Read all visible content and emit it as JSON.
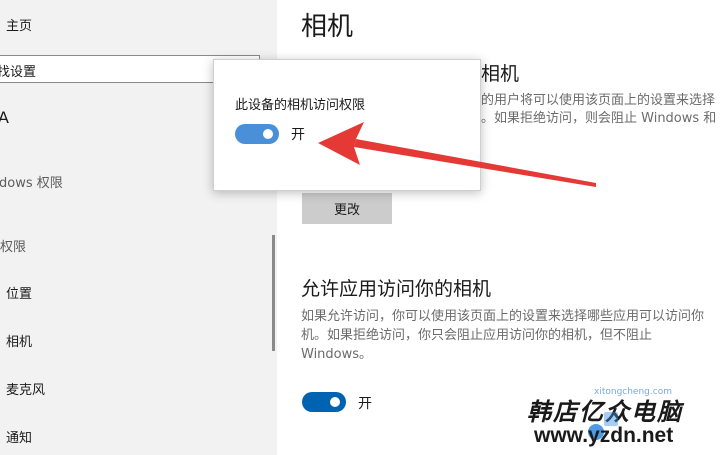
{
  "sidebar": {
    "home": "主页",
    "search_placeholder": "找设置",
    "section_fragment": "A",
    "windows_permissions": "dows 权限",
    "app_permissions": "权限",
    "items": [
      {
        "label": "位置"
      },
      {
        "label": "相机"
      },
      {
        "label": "麦克风"
      },
      {
        "label": "通知"
      }
    ]
  },
  "main": {
    "title": "相机",
    "device_section": {
      "heading_fragment": "相机",
      "desc_lines": [
        "的用户将可以使用该页面上的设置来选择",
        "。如果拒绝访问，则会阻止 Windows 和"
      ],
      "change_button": "更改"
    },
    "apps_section": {
      "heading": "允许应用访问你的相机",
      "desc_lines": [
        "如果允许访问，你可以使用该页面上的设置来选择哪些应用可以访问你",
        "机。如果拒绝访问，你只会阻止应用访问你的相机，但不阻止",
        "Windows。"
      ],
      "toggle_label": "开",
      "toggle_on": true
    }
  },
  "popup": {
    "title": "此设备的相机访问权限",
    "toggle_label": "开",
    "toggle_on": true
  },
  "watermark": {
    "line1": "韩店亿众电脑",
    "line2": "www.yzdn.net",
    "small": "xitongcheng.com"
  },
  "colors": {
    "accent": "#0063b1",
    "popup_toggle": "#4a90d9",
    "arrow": "#e53935",
    "sidebar_bg": "#f2f2f2"
  }
}
